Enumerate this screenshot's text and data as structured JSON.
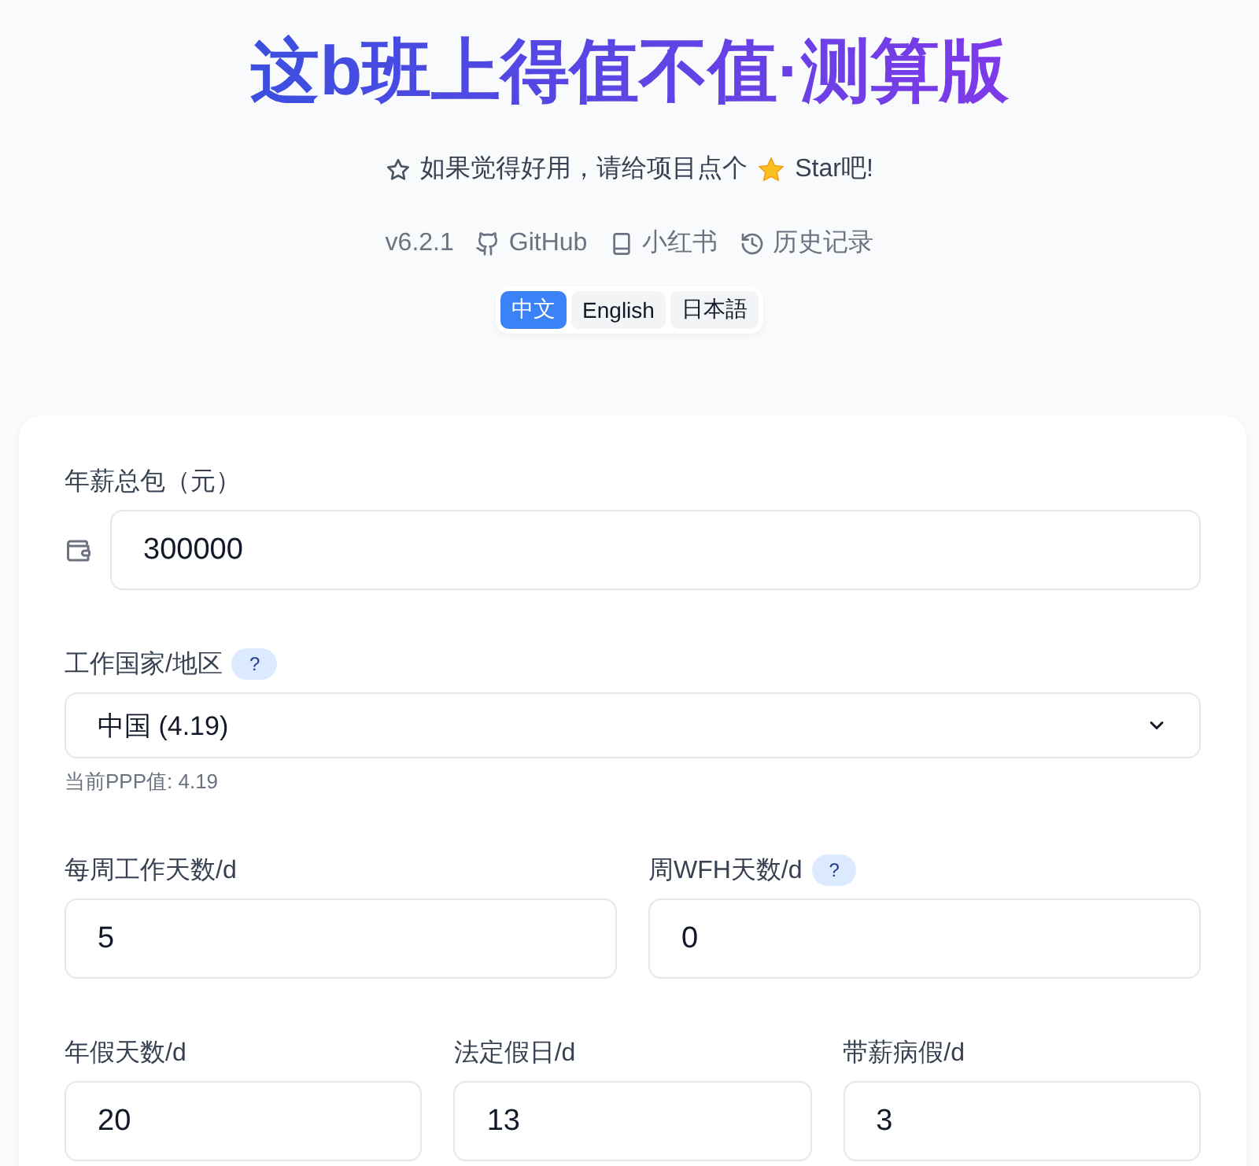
{
  "header": {
    "title": "这b班上得值不值·测算版",
    "star_prompt": {
      "before": "如果觉得好用，请给项目点个",
      "after": "Star吧!"
    },
    "links": [
      {
        "kind": "version",
        "label": "v6.2.1"
      },
      {
        "kind": "github",
        "label": "GitHub"
      },
      {
        "kind": "book",
        "label": "小红书"
      },
      {
        "kind": "history",
        "label": "历史记录"
      }
    ],
    "languages": [
      {
        "label": "中文",
        "selected": true
      },
      {
        "label": "English",
        "selected": false
      },
      {
        "label": "日本語",
        "selected": false
      }
    ]
  },
  "form": {
    "rows": [
      {
        "fields": [
          {
            "kind": "wallet_input",
            "label": "年薪总包（元）",
            "value": "300000"
          }
        ]
      },
      {
        "fields": [
          {
            "kind": "select",
            "label": "工作国家/地区",
            "help": "?",
            "value": "中国 (4.19)",
            "hint": "当前PPP值: 4.19"
          }
        ]
      },
      {
        "fields": [
          {
            "kind": "input",
            "label": "每周工作天数/d",
            "value": "5"
          },
          {
            "kind": "input",
            "label": "周WFH天数/d",
            "help": "?",
            "value": "0"
          }
        ]
      },
      {
        "fields": [
          {
            "kind": "input",
            "label": "年假天数/d",
            "value": "20"
          },
          {
            "kind": "input",
            "label": "法定假日/d",
            "value": "13"
          },
          {
            "kind": "input",
            "label": "带薪病假/d",
            "value": "3"
          }
        ]
      }
    ]
  }
}
